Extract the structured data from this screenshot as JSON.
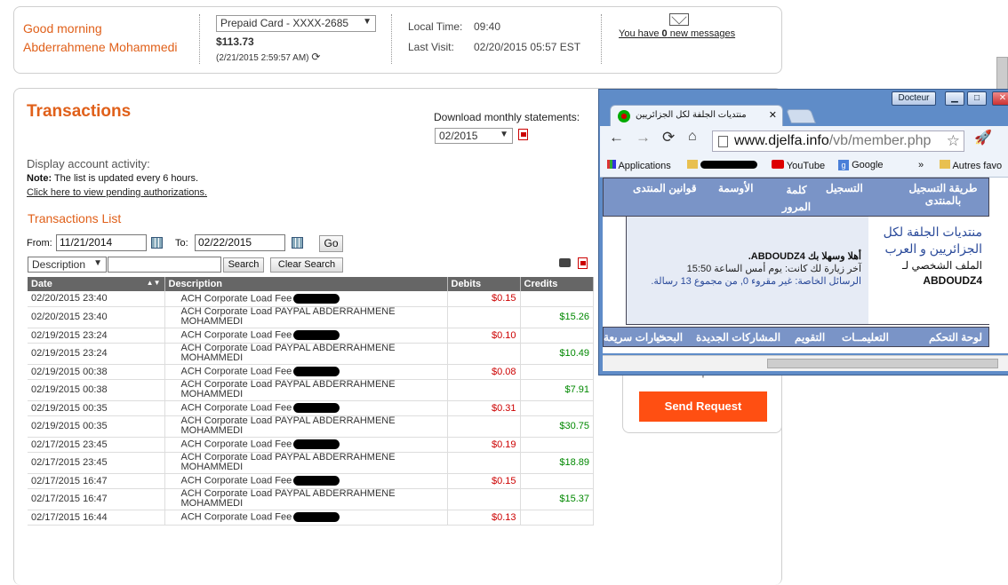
{
  "header": {
    "greeting_line1": "Good morning",
    "greeting_line2": "Abderrahmene Mohammedi",
    "card_select": "Prepaid Card - XXXX-2685",
    "balance": "$113.73",
    "balance_date": "(2/21/2015 2:59:57 AM)",
    "local_time_label": "Local Time:",
    "local_time": "09:40",
    "last_visit_label": "Last Visit:",
    "last_visit": "02/20/2015 05:57 EST",
    "messages_prefix": "You have ",
    "messages_count": "0",
    "messages_suffix": " new messages"
  },
  "main": {
    "title": "Transactions",
    "download_label": "Download monthly statements:",
    "month_select": "02/2015",
    "display_activity": "Display account activity:",
    "note_label": "Note:",
    "note_text": " The list is updated every 6 hours.",
    "pending_link": "Click here to view pending authorizations.",
    "list_title": "Transactions List",
    "from_label": "From:",
    "from_value": "11/21/2014",
    "to_label": "To:",
    "to_value": "02/22/2015",
    "go_button": "Go",
    "filter_select": "Description",
    "search_button": "Search",
    "clear_button": "Clear Search"
  },
  "table": {
    "columns": [
      "Date",
      "Description",
      "Debits",
      "Credits"
    ],
    "rows": [
      {
        "date": "02/20/2015 23:40",
        "desc": "ACH Corporate Load Fee",
        "debit": "$0.15",
        "credit": ""
      },
      {
        "date": "02/20/2015 23:40",
        "desc": "ACH Corporate Load PAYPAL ABDERRAHMENE MOHAMMEDI",
        "debit": "",
        "credit": "$15.26"
      },
      {
        "date": "02/19/2015 23:24",
        "desc": "ACH Corporate Load Fee",
        "debit": "$0.10",
        "credit": ""
      },
      {
        "date": "02/19/2015 23:24",
        "desc": "ACH Corporate Load PAYPAL ABDERRAHMENE MOHAMMEDI",
        "debit": "",
        "credit": "$10.49"
      },
      {
        "date": "02/19/2015 00:38",
        "desc": "ACH Corporate Load Fee",
        "debit": "$0.08",
        "credit": ""
      },
      {
        "date": "02/19/2015 00:38",
        "desc": "ACH Corporate Load PAYPAL ABDERRAHMENE MOHAMMEDI",
        "debit": "",
        "credit": "$7.91"
      },
      {
        "date": "02/19/2015 00:35",
        "desc": "ACH Corporate Load Fee",
        "debit": "$0.31",
        "credit": ""
      },
      {
        "date": "02/19/2015 00:35",
        "desc": "ACH Corporate Load PAYPAL ABDERRAHMENE MOHAMMEDI",
        "debit": "",
        "credit": "$30.75"
      },
      {
        "date": "02/17/2015 23:45",
        "desc": "ACH Corporate Load Fee",
        "debit": "$0.19",
        "credit": ""
      },
      {
        "date": "02/17/2015 23:45",
        "desc": "ACH Corporate Load PAYPAL ABDERRAHMENE MOHAMMEDI",
        "debit": "",
        "credit": "$18.89"
      },
      {
        "date": "02/17/2015 16:47",
        "desc": "ACH Corporate Load Fee",
        "debit": "$0.15",
        "credit": ""
      },
      {
        "date": "02/17/2015 16:47",
        "desc": "ACH Corporate Load PAYPAL ABDERRAHMENE MOHAMMEDI",
        "debit": "",
        "credit": "$15.37"
      },
      {
        "date": "02/17/2015 16:44",
        "desc": "ACH Corporate Load Fee",
        "debit": "$0.13",
        "credit": ""
      }
    ]
  },
  "side": {
    "partial_text": "US companies",
    "send_button": "Send Request"
  },
  "chrome": {
    "profile": "Docteur",
    "tab_title": "منتديات الجلفة لكل الجزائريين",
    "url_host": "www.djelfa.info",
    "url_path": "/vb/member.php",
    "bookmarks": {
      "apps": "Applications",
      "youtube": "YouTube",
      "google": "Google",
      "more": "»",
      "other": "Autres favo"
    },
    "nav_top": [
      "طريقة التسجيل بالمنتدى",
      "التسجيل",
      "كلمة المرور",
      "الأوسمة",
      "قوانين المنتدى"
    ],
    "welcome": "أهلا وسهلا بك ABDOUDZ4.",
    "last_visit": "آخر زيارة لك كانت: يوم أمس الساعة 15:50",
    "pm": "الرسائل الخاصة: غير مقروء 0, من مجموع 13 رسالة.",
    "forum_name": "منتديات الجلفة لكل الجزائريين و العرب",
    "profile_label": "الملف الشخصي لـ",
    "username": "ABDOUDZ4",
    "nav_bottom": [
      "لوحة التحكم",
      "التعليمــات",
      "التقويم",
      "المشاركات الجديدة",
      "البحث",
      "خيارات سريعة"
    ],
    "colors": {
      "frame": "#5f8cc8",
      "forum_nav": "#7a94c7"
    }
  }
}
